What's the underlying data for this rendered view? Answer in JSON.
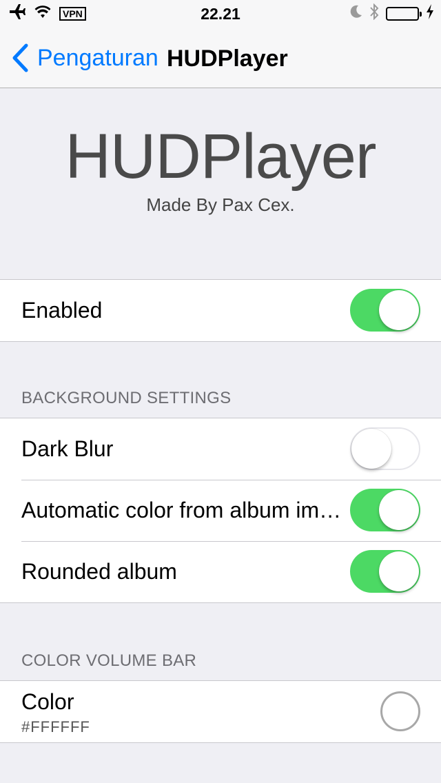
{
  "status_bar": {
    "vpn": "VPN",
    "time": "22.21",
    "icons": [
      "airplane-icon",
      "wifi-icon",
      "moon-icon",
      "bluetooth-icon",
      "battery-icon",
      "charging-icon"
    ],
    "battery_color": "#4cd964"
  },
  "nav": {
    "back_label": "Pengaturan",
    "title": "HUDPlayer",
    "accent": "#007aff"
  },
  "header": {
    "title": "HUDPlayer",
    "subtitle": "Made By Pax Cex."
  },
  "main": {
    "enabled": {
      "label": "Enabled",
      "on": true
    }
  },
  "background_settings": {
    "header": "BACKGROUND SETTINGS",
    "items": [
      {
        "label": "Dark Blur",
        "on": false
      },
      {
        "label": "Automatic color from album image",
        "on": true
      },
      {
        "label": "Rounded album",
        "on": true
      }
    ]
  },
  "color_volume_bar": {
    "header": "COLOR VOLUME BAR",
    "label": "Color",
    "value": "#FFFFFF"
  }
}
